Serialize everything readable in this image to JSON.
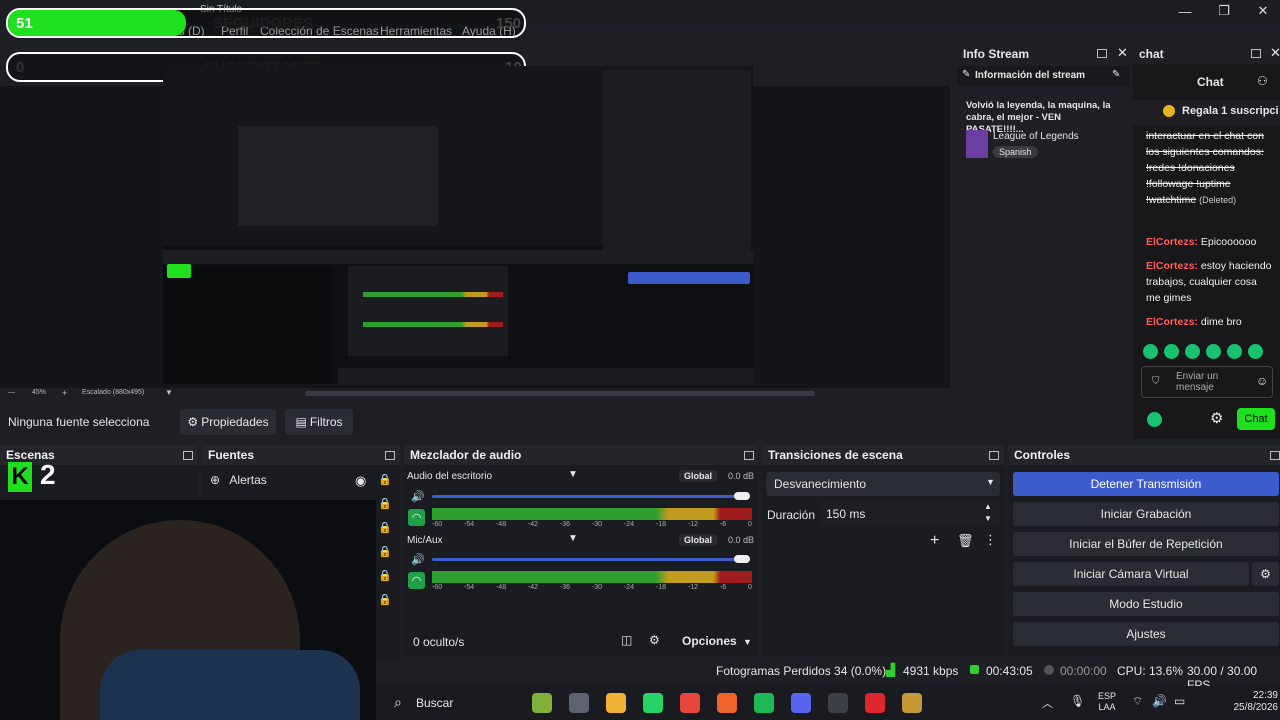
{
  "window": {
    "title": "Sin Título",
    "controls": [
      "—",
      "❐",
      "✕"
    ]
  },
  "menu": [
    "es (D)",
    "Perfil",
    "Colección de Escenas",
    "Herramientas",
    "Ayuda (H)"
  ],
  "overlay": {
    "followers_label": "SEGUIDORES",
    "followers_current": "51",
    "followers_goal": "150",
    "subs_label": "SUSCRIPTORES",
    "subs_current": "0",
    "subs_goal": "10"
  },
  "preview": {
    "zoom": "45%",
    "scale_label": "Escalado (880x495)"
  },
  "source_bar": {
    "no_source": "Ninguna fuente selecciona",
    "properties": "Propiedades",
    "filters": "Filtros"
  },
  "info_stream": {
    "header": "Info Stream",
    "section": "Información del stream",
    "title": "Volvió la leyenda, la maquina, la cabra, el mejor - VEN PASATE!!!!...",
    "game": "League of Legends",
    "language": "Spanish"
  },
  "chat": {
    "header": "chat",
    "title": "Chat",
    "pinned": "Regala 1 suscripci",
    "messages": [
      {
        "user": "",
        "text": "interactuar en el chat con los siguientes comandos: !redes !donaciones !followage !uptime !watchtime",
        "suffix": "(Deleted)"
      },
      {
        "user": "ElCortezs:",
        "text": "Epicoooooo"
      },
      {
        "user": "ElCortezs:",
        "text": "estoy haciendo trabajos, cualquier cosa me gimes"
      },
      {
        "user": "ElCortezs:",
        "text": "dime bro"
      }
    ],
    "input_placeholder": "Enviar un mensaje",
    "send": "Chat"
  },
  "scenes": {
    "header": "Escenas",
    "logo_text": "2"
  },
  "sources": {
    "header": "Fuentes",
    "items": [
      "Alertas"
    ]
  },
  "mixer": {
    "header": "Mezclador de audio",
    "channels": [
      {
        "name": "Audio del escritorio",
        "badge": "Global",
        "db": "0.0 dB"
      },
      {
        "name": "Mic/Aux",
        "badge": "Global",
        "db": "0.0 dB"
      }
    ],
    "scale": [
      "-60",
      "-54",
      "-48",
      "-42",
      "-36",
      "-30",
      "-24",
      "-18",
      "-12",
      "-6",
      "0"
    ],
    "hidden": "0 oculto/s",
    "options": "Opciones"
  },
  "transitions": {
    "header": "Transiciones de escena",
    "selected": "Desvanecimiento",
    "duration_label": "Duración",
    "duration_value": "150 ms"
  },
  "controls": {
    "header": "Controles",
    "buttons": [
      "Detener Transmisión",
      "Iniciar Grabación",
      "Iniciar el Búfer de Repetición",
      "Iniciar Cámara Virtual",
      "Modo Estudio",
      "Ajustes"
    ]
  },
  "status": {
    "dropped": "Fotogramas Perdidos 34 (0.0%)",
    "bitrate": "4931 kbps",
    "live_time": "00:43:05",
    "rec_time": "00:00:00",
    "cpu": "CPU: 13.6%",
    "fps": "30.00 / 30.00 FPS"
  },
  "taskbar": {
    "search": "Buscar",
    "lang": "ESP",
    "lang2": "LAA",
    "time": "22:39",
    "date": "25/8/2026",
    "icon_colors": [
      "#7fb13c",
      "#5c6270",
      "#f2b233",
      "#25d366",
      "#e8453c",
      "#f0622c",
      "#1db954",
      "#5865f2",
      "#3d3f47",
      "#e0262e",
      "#c59a3a"
    ]
  }
}
